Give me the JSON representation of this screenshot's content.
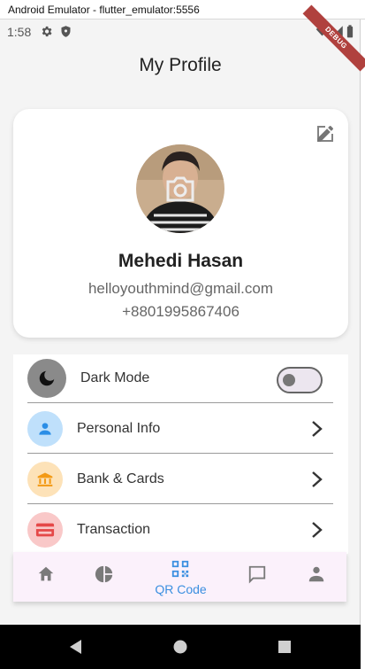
{
  "window": {
    "title": "Android Emulator - flutter_emulator:5556"
  },
  "status_bar": {
    "time": "1:58",
    "icons": [
      "gear-icon",
      "shield-icon",
      "wifi-icon",
      "signal-icon",
      "battery-icon"
    ],
    "debug_banner": "DEBUG"
  },
  "app_bar": {
    "title": "My Profile"
  },
  "profile": {
    "name": "Mehedi Hasan",
    "email": "helloyouthmind@gmail.com",
    "phone": "+8801995867406",
    "edit_icon": "edit-icon",
    "camera_icon": "camera-icon"
  },
  "settings": {
    "dark_mode": {
      "label": "Dark Mode",
      "enabled": false,
      "icon": "moon-icon",
      "icon_bg": "#8a8a8a"
    },
    "items": [
      {
        "label": "Personal Info",
        "icon": "person-icon",
        "icon_bg": "#bfe0fb",
        "icon_color": "#2b8ee6"
      },
      {
        "label": "Bank & Cards",
        "icon": "bank-icon",
        "icon_bg": "#fde2b8",
        "icon_color": "#f39a16"
      },
      {
        "label": "Transaction",
        "icon": "credit-card-icon",
        "icon_bg": "#f9c8c8",
        "icon_color": "#e54848"
      }
    ]
  },
  "bottom_nav": {
    "items": [
      {
        "icon": "home-icon",
        "label": ""
      },
      {
        "icon": "pie-chart-icon",
        "label": ""
      },
      {
        "icon": "qr-code-icon",
        "label": "QR Code",
        "active": true
      },
      {
        "icon": "chat-icon",
        "label": ""
      },
      {
        "icon": "person-icon",
        "label": ""
      }
    ],
    "active_color": "#3b8fe0",
    "inactive_color": "#7a7a7a"
  },
  "system_nav": [
    "back-icon",
    "home-circle-icon",
    "recents-icon"
  ]
}
